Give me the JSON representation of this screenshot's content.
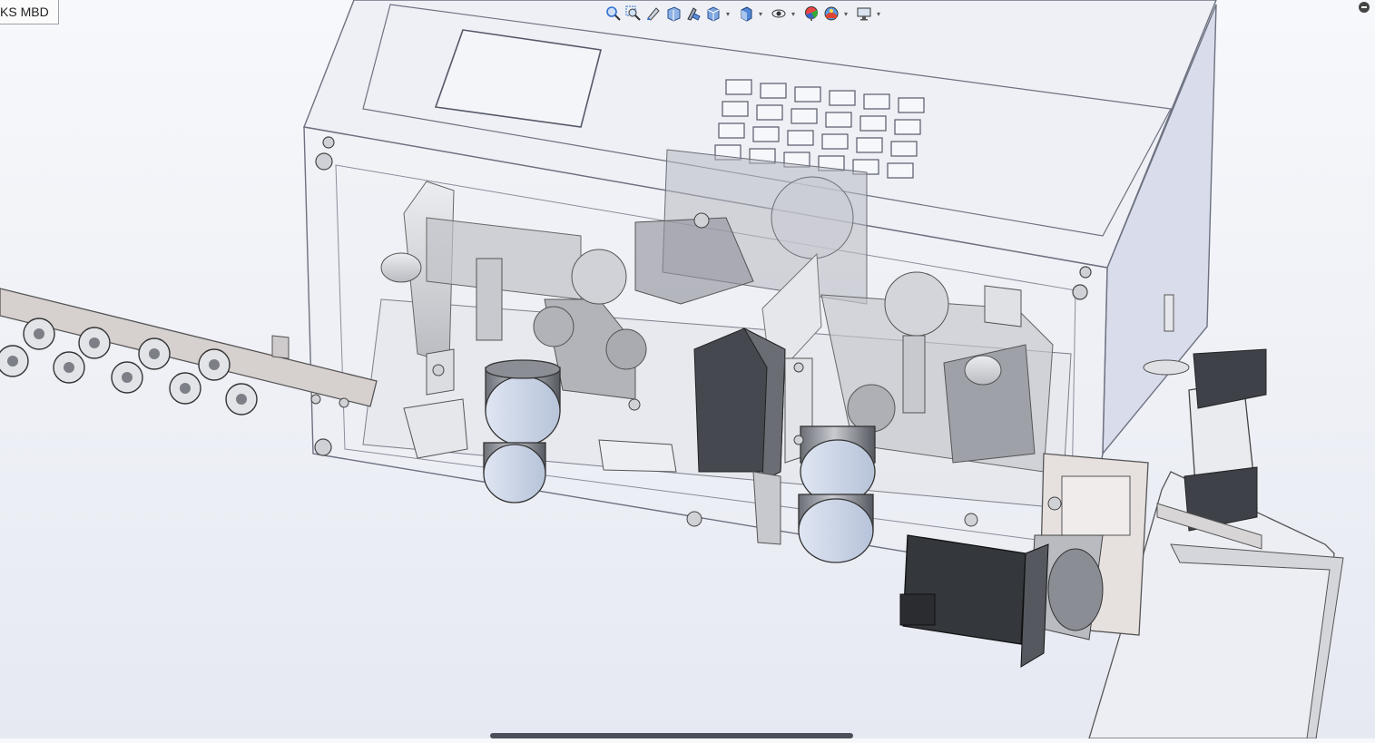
{
  "tab": {
    "label": "KS MBD"
  },
  "hud": {
    "items": [
      {
        "name": "zoom-to-fit-icon"
      },
      {
        "name": "zoom-to-area-icon"
      },
      {
        "name": "previous-view-icon"
      },
      {
        "name": "section-view-icon"
      },
      {
        "name": "dynamic-annotation-icon"
      },
      {
        "name": "view-orientation-icon",
        "dropdown": true
      },
      {
        "name": "display-style-icon",
        "dropdown": true
      },
      {
        "name": "hide-show-items-icon",
        "dropdown": true
      },
      {
        "name": "edit-appearance-icon"
      },
      {
        "name": "apply-scene-icon",
        "dropdown": true
      },
      {
        "name": "view-settings-icon",
        "dropdown": true
      }
    ],
    "dropdown_glyph": "▾"
  },
  "colors": {
    "accent": "#2f6fd0",
    "steel": "#d4d6db",
    "motor": "#3a3d42",
    "glass": "#e9ecf4"
  }
}
